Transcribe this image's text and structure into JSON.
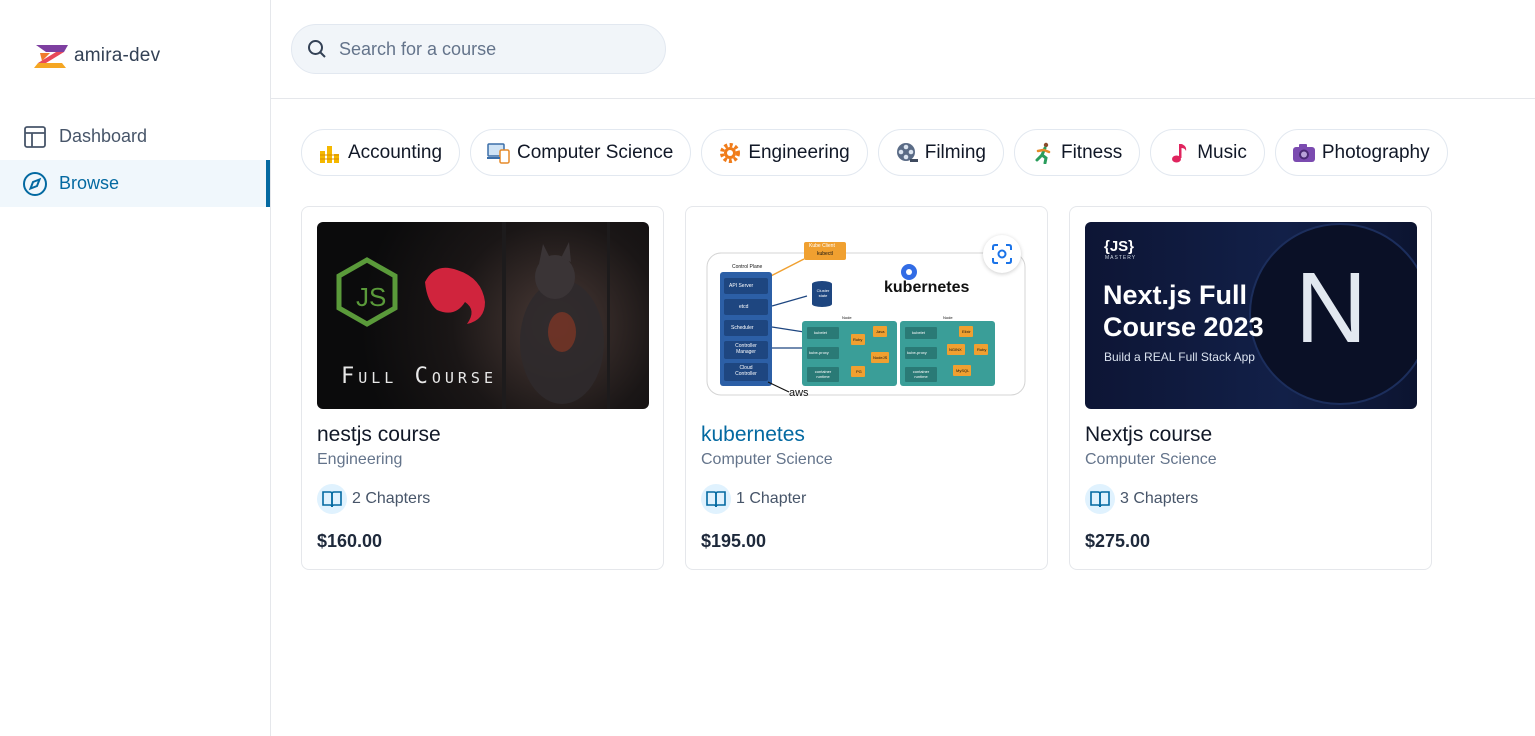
{
  "brand": {
    "name": "amira-dev"
  },
  "sidebar": {
    "items": [
      {
        "label": "Dashboard",
        "icon": "layout-icon",
        "active": false
      },
      {
        "label": "Browse",
        "icon": "compass-icon",
        "active": true
      }
    ]
  },
  "search": {
    "placeholder": "Search for a course",
    "value": ""
  },
  "categories": [
    {
      "label": "Accounting",
      "icon": "bar-chart-icon"
    },
    {
      "label": "Computer Science",
      "icon": "devices-icon"
    },
    {
      "label": "Engineering",
      "icon": "gear-icon"
    },
    {
      "label": "Filming",
      "icon": "film-reel-icon"
    },
    {
      "label": "Fitness",
      "icon": "runner-icon"
    },
    {
      "label": "Music",
      "icon": "music-note-icon"
    },
    {
      "label": "Photography",
      "icon": "camera-icon"
    }
  ],
  "courses": [
    {
      "title": "nestjs course",
      "category": "Engineering",
      "chapters": "2 Chapters",
      "price": "$160.00",
      "thumb_text": "Full Course",
      "thumb_badge": "JS"
    },
    {
      "title": "kubernetes",
      "category": "Computer Science",
      "chapters": "1 Chapter",
      "price": "$195.00",
      "thumb": {
        "heading": "kubernetes",
        "kube_client": "Kube Client",
        "kubectl": "kubectl",
        "control_plane": "Control Plane",
        "cp_items": [
          "API Server",
          "etcd",
          "Scheduler",
          "Controller Manager",
          "Cloud Controller"
        ],
        "cluster_state": "Cluster state",
        "node": "Node",
        "node1": [
          "kubelet",
          "kube-proxy",
          "container runtime"
        ],
        "node1_apps": [
          "Ruby",
          "Java",
          "NodeJS",
          "PG"
        ],
        "node2": [
          "kubelet",
          "kube-proxy",
          "container runtime"
        ],
        "node2_apps": [
          "Elixir",
          "NGINX",
          "Ruby",
          "MySQL"
        ],
        "aws": "aws"
      }
    },
    {
      "title": "Nextjs course",
      "category": "Computer Science",
      "chapters": "3 Chapters",
      "price": "$275.00",
      "thumb": {
        "badge": "{JS}",
        "badge_sub": "MASTERY",
        "line1": "Next.js Full",
        "line2": "Course 2023",
        "subtitle": "Build a REAL Full Stack App",
        "letter": "N"
      }
    }
  ],
  "colors": {
    "accent": "#0369a1",
    "active_bg": "#f0f7fc",
    "k8s_blue": "#2c5fa6",
    "k8s_teal": "#3a9e98",
    "k8s_orange": "#f0a030"
  }
}
